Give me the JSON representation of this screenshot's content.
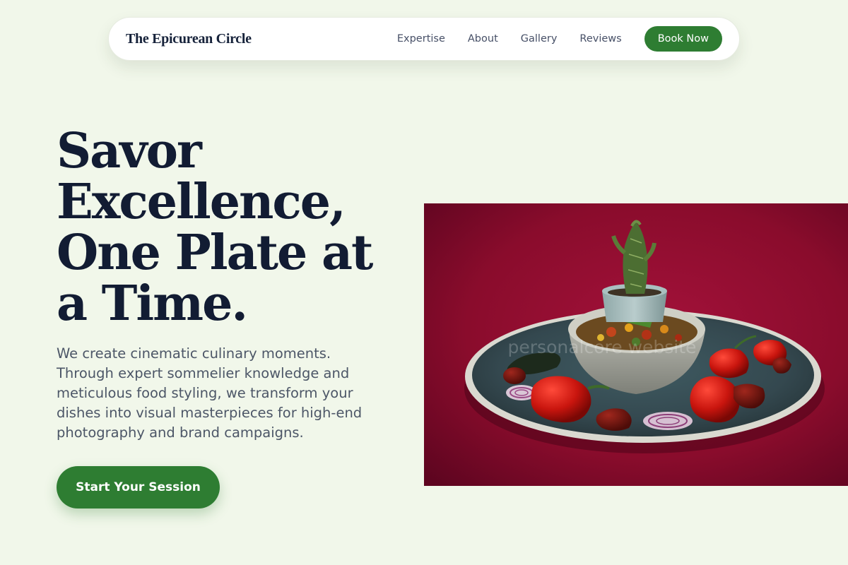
{
  "brand": {
    "name": "The Epicurean Circle"
  },
  "nav": {
    "links": [
      "Expertise",
      "About",
      "Gallery",
      "Reviews"
    ],
    "cta_label": "Book Now"
  },
  "hero": {
    "title": "Savor Excellence, One Plate at a Time.",
    "description": "We create cinematic culinary moments. Through expert sommelier knowledge and meticulous food styling, we transform your dishes into visual masterpieces for high-end photography and brand campaigns.",
    "cta_label": "Start Your Session"
  },
  "photo": {
    "watermark": "personalcore website"
  },
  "colors": {
    "page_background": "#f1f7ea",
    "accent_green": "#2e7d32",
    "heading_navy": "#121c33",
    "body_text": "#4c5667",
    "photo_backdrop": "#8a0c2c"
  }
}
